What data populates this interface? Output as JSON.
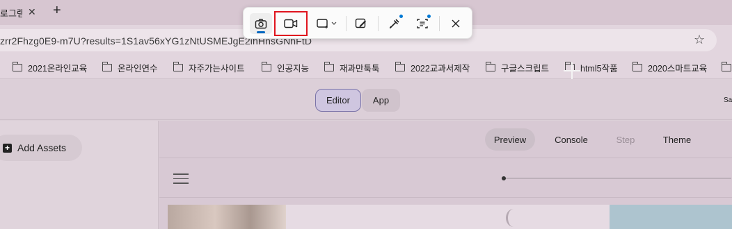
{
  "browser": {
    "tab_title": "로그램",
    "new_tab_symbol": "+",
    "url": "zrr2Fhzg0E9-m7U?results=1S1av56xYG1zNtUSMEJgE2ihHnsGNhFtD"
  },
  "bookmarks": [
    {
      "label": "2021온라인교육"
    },
    {
      "label": "온라인연수"
    },
    {
      "label": "자주가는사이트"
    },
    {
      "label": "인공지능"
    },
    {
      "label": "재과만툭툭"
    },
    {
      "label": "2022교과서제작"
    },
    {
      "label": "구글스크립트"
    },
    {
      "label": "html5작품"
    },
    {
      "label": "2020스마트교육"
    }
  ],
  "app": {
    "mode_tabs": [
      {
        "label": "Editor",
        "active": true
      },
      {
        "label": "App",
        "active": false
      }
    ],
    "right_text": "Sa",
    "left_panel": {
      "add_assets_label": "Add Assets"
    },
    "nav": [
      {
        "label": "Preview",
        "active": true
      },
      {
        "label": "Console",
        "active": false
      },
      {
        "label": "Step",
        "disabled": true
      },
      {
        "label": "Theme",
        "active": false
      }
    ],
    "progress": 0.02
  },
  "snipping_toolbar": {
    "tools": [
      {
        "name": "screenshot",
        "icon": "camera-icon",
        "selected": true
      },
      {
        "name": "video",
        "icon": "video-camera-icon",
        "highlighted_box_color": "#e0141e"
      },
      {
        "name": "rectangle-mode",
        "icon": "rectangle-select-icon"
      },
      {
        "name": "edit",
        "icon": "edit-image-icon"
      },
      {
        "name": "color-picker",
        "icon": "color-picker-icon"
      },
      {
        "name": "text-extract",
        "icon": "text-extract-icon"
      },
      {
        "name": "close",
        "icon": "close-icon"
      }
    ],
    "accent_color": "#0067c0"
  }
}
